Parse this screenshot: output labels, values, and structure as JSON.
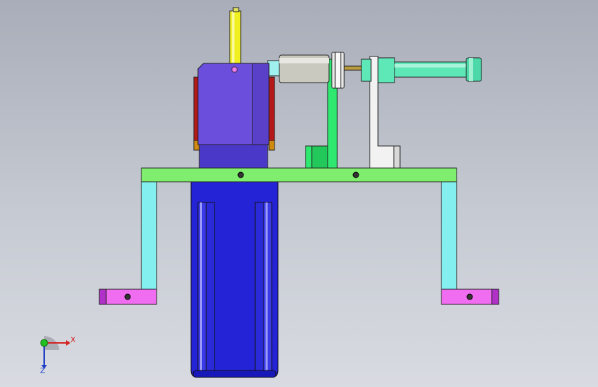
{
  "viewport": {
    "background_top": "#a9adb9",
    "background_bottom": "#d8dbe1"
  },
  "model": {
    "parts": [
      {
        "name": "base-plate",
        "color": "#7fee6f"
      },
      {
        "name": "left-leg",
        "color": "#83f0ef"
      },
      {
        "name": "right-leg",
        "color": "#83f0ef"
      },
      {
        "name": "left-foot",
        "color": "#f06cf0"
      },
      {
        "name": "right-foot",
        "color": "#f06cf0"
      },
      {
        "name": "motor-body",
        "color": "#2424d6"
      },
      {
        "name": "gearbox-housing",
        "color": "#6b4fdc"
      },
      {
        "name": "side-plate",
        "color": "#b51818"
      },
      {
        "name": "vertical-shaft",
        "color": "#f0f020"
      },
      {
        "name": "green-bracket",
        "color": "#2ee870"
      },
      {
        "name": "white-bracket",
        "color": "#f2f2f2"
      },
      {
        "name": "grey-cylinder",
        "color": "#c9c9c0"
      },
      {
        "name": "teal-cylinder",
        "color": "#5ee8b8"
      }
    ]
  },
  "triad": {
    "x_label": "X",
    "z_label": "Z",
    "x_color": "#d42020",
    "y_color": "#20c020",
    "z_color": "#1f3fc6"
  }
}
